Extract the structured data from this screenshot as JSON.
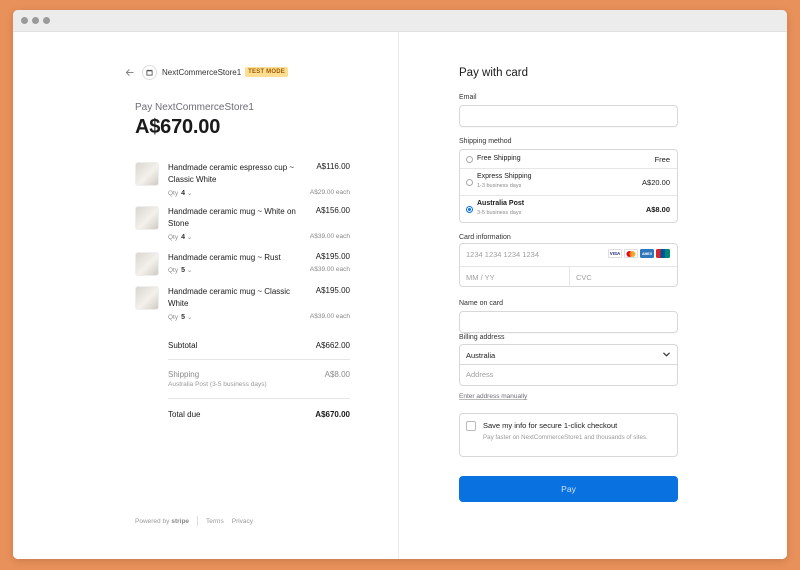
{
  "store": {
    "name": "NextCommerceStore1",
    "test_badge": "TEST MODE",
    "pay_label": "Pay NextCommerceStore1",
    "total_display": "A$670.00"
  },
  "items": [
    {
      "name": "Handmade ceramic espresso cup ~ Classic White",
      "price": "A$116.00",
      "qty_label": "Qty",
      "qty": "4",
      "each": "A$29.00 each"
    },
    {
      "name": "Handmade ceramic mug ~ White on Stone",
      "price": "A$156.00",
      "qty_label": "Qty",
      "qty": "4",
      "each": "A$39.00 each"
    },
    {
      "name": "Handmade ceramic mug ~ Rust",
      "price": "A$195.00",
      "qty_label": "Qty",
      "qty": "5",
      "each": "A$39.00 each"
    },
    {
      "name": "Handmade ceramic mug ~ Classic White",
      "price": "A$195.00",
      "qty_label": "Qty",
      "qty": "5",
      "each": "A$39.00 each"
    }
  ],
  "summary": {
    "subtotal_label": "Subtotal",
    "subtotal_value": "A$662.00",
    "shipping_label": "Shipping",
    "shipping_detail": "Australia Post (3-5 business days)",
    "shipping_value": "A$8.00",
    "total_label": "Total due",
    "total_value": "A$670.00"
  },
  "footer": {
    "powered_by": "Powered by",
    "stripe": "stripe",
    "terms": "Terms",
    "privacy": "Privacy"
  },
  "form": {
    "title": "Pay with card",
    "email_label": "Email",
    "shipping_method_label": "Shipping method",
    "shipping_options": [
      {
        "name": "Free Shipping",
        "sub": "",
        "price": "Free",
        "selected": false
      },
      {
        "name": "Express Shipping",
        "sub": "1-3 business days",
        "price": "A$20.00",
        "selected": false
      },
      {
        "name": "Australia Post",
        "sub": "3-5 business days",
        "price": "A$8.00",
        "selected": true
      }
    ],
    "card_label": "Card information",
    "card_number_placeholder": "1234 1234 1234 1234",
    "expiry_placeholder": "MM / YY",
    "cvc_placeholder": "CVC",
    "card_brands": [
      "VISA",
      "mastercard",
      "AMEX",
      "UnionPay"
    ],
    "name_label": "Name on card",
    "billing_label": "Billing address",
    "country": "Australia",
    "address_placeholder": "Address",
    "manual_link": "Enter address manually",
    "save_title": "Save my info for secure 1-click checkout",
    "save_desc": "Pay faster on NextCommerceStore1 and thousands of sites.",
    "pay_button": "Pay"
  },
  "colors": {
    "background": "#e9915a",
    "accent": "#0a72e0",
    "test_badge_bg": "#ffde92"
  }
}
